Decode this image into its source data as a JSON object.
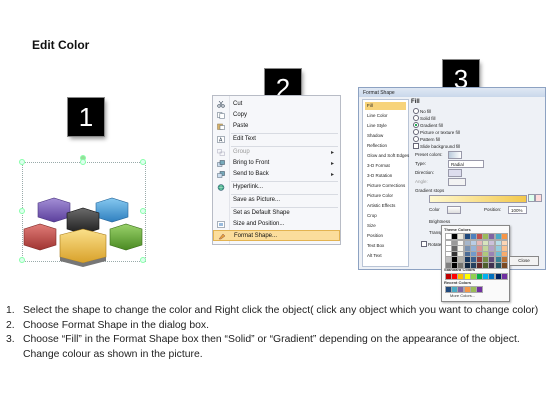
{
  "title": "Edit Color",
  "badges": [
    "1",
    "2",
    "3"
  ],
  "context_menu": {
    "items": [
      {
        "label": "Cut",
        "icon": "scissors-icon",
        "disabled": false,
        "arrow": false,
        "highlight": false
      },
      {
        "label": "Copy",
        "icon": "copy-icon",
        "disabled": false,
        "arrow": false,
        "highlight": false
      },
      {
        "label": "Paste",
        "icon": "paste-icon",
        "disabled": false,
        "arrow": false,
        "highlight": false
      },
      {
        "label": "Edit Text",
        "icon": "edit-text-icon",
        "disabled": false,
        "arrow": false,
        "highlight": false
      },
      {
        "label": "Group",
        "icon": "group-icon",
        "disabled": true,
        "arrow": true,
        "highlight": false
      },
      {
        "label": "Bring to Front",
        "icon": "bring-front-icon",
        "disabled": false,
        "arrow": true,
        "highlight": false
      },
      {
        "label": "Send to Back",
        "icon": "send-back-icon",
        "disabled": false,
        "arrow": true,
        "highlight": false
      },
      {
        "label": "Hyperlink...",
        "icon": "hyperlink-icon",
        "disabled": false,
        "arrow": false,
        "highlight": false
      },
      {
        "label": "Save as Picture...",
        "icon": "",
        "disabled": false,
        "arrow": false,
        "highlight": false
      },
      {
        "label": "Set as Default Shape",
        "icon": "",
        "disabled": false,
        "arrow": false,
        "highlight": false
      },
      {
        "label": "Size and Position...",
        "icon": "size-position-icon",
        "disabled": false,
        "arrow": false,
        "highlight": false
      },
      {
        "label": "Format Shape...",
        "icon": "format-shape-icon",
        "disabled": false,
        "arrow": false,
        "highlight": true
      }
    ]
  },
  "format_dialog": {
    "title": "Format Shape",
    "categories": [
      "Fill",
      "Line Color",
      "Line Style",
      "Shadow",
      "Reflection",
      "Glow and Soft Edges",
      "3-D Format",
      "3-D Rotation",
      "Picture Corrections",
      "Picture Color",
      "Artistic Effects",
      "Crop",
      "Size",
      "Position",
      "Text Box",
      "Alt Text"
    ],
    "section_title": "Fill",
    "fill_options": [
      {
        "label": "No fill",
        "checked": false
      },
      {
        "label": "Solid fill",
        "checked": false
      },
      {
        "label": "Gradient fill",
        "checked": true
      },
      {
        "label": "Picture or texture fill",
        "checked": false
      },
      {
        "label": "Pattern fill",
        "checked": false
      }
    ],
    "slide_background": "Slide background fill",
    "preset_colors": "Preset colors:",
    "type_label": "Type:",
    "type_value": "Radial",
    "direction_label": "Direction:",
    "angle_label": "Angle:",
    "gradient_stops": "Gradient stops",
    "color_label": "Color",
    "position_label": "Position:",
    "position_value": "100%",
    "brightness_label": "Brightness",
    "transparency_label": "Transparency",
    "rotate_label": "Rotate",
    "close_button": "Close"
  },
  "palette": {
    "theme_colors": "Theme Colors",
    "standard_colors": "Standard Colors",
    "recent_colors": "Recent Colors",
    "more_colors": "More Colors..."
  },
  "steps": [
    {
      "n": "1.",
      "text": "Select the shape to change the color and Right click the object( click any object which you want to change color)"
    },
    {
      "n": "2.",
      "text": "Choose Format Shape in the dialog box."
    },
    {
      "n": "3.",
      "text": "Choose “Fill” in the Format Shape box then “Solid” or “Gradient” depending on the appearance of the object. Change colour as shown in the picture."
    }
  ],
  "colors": {
    "hex_purple": "#7a5fb4",
    "hex_blue": "#4aa0d8",
    "hex_red": "#c8504e",
    "hex_dark": "#3b3b3b",
    "hex_green": "#6cad3c",
    "hex_yellow": "#f0c24a",
    "highlight": "#fbdd9c"
  }
}
